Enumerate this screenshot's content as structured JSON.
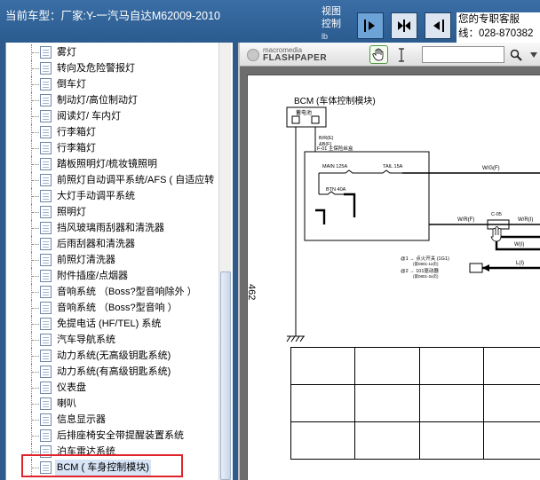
{
  "header": {
    "car_model": "当前车型：厂家:Y-一汽马自达M62009-2010",
    "view_control_label": "视图控制",
    "view_control_suffix": "lb",
    "contact_line1": "您的专职客服",
    "contact_line2": "线：028-870382"
  },
  "view_buttons": [
    {
      "icon": "arrow-right-bar-icon"
    },
    {
      "icon": "split-arrows-icon"
    },
    {
      "icon": "arrow-left-bar-icon"
    }
  ],
  "tree": {
    "items": [
      {
        "label": "雾灯"
      },
      {
        "label": "转向及危险警报灯"
      },
      {
        "label": "倒车灯"
      },
      {
        "label": "制动灯/高位制动灯"
      },
      {
        "label": "阅读灯/ 车内灯"
      },
      {
        "label": "行李箱灯"
      },
      {
        "label": "行李箱灯"
      },
      {
        "label": "踏板照明灯/梳妆镜照明"
      },
      {
        "label": "前照灯自动调平系统/AFS ( 自适应转"
      },
      {
        "label": "大灯手动调平系统"
      },
      {
        "label": "照明灯"
      },
      {
        "label": "挡风玻璃雨刮器和清洗器"
      },
      {
        "label": "后雨刮器和清洗器"
      },
      {
        "label": "前照灯清洗器"
      },
      {
        "label": "附件插座/点烟器"
      },
      {
        "label": "音响系统  （Boss?型音响除外 ）"
      },
      {
        "label": "音响系统  （Boss?型音响 ）"
      },
      {
        "label": "免提电话 (HF/TEL) 系统"
      },
      {
        "label": "汽车导航系统"
      },
      {
        "label": "动力系统(无高级钥匙系统)"
      },
      {
        "label": "动力系统(有高级钥匙系统)"
      },
      {
        "label": "仪表盘"
      },
      {
        "label": "喇叭"
      },
      {
        "label": "信息显示器"
      },
      {
        "label": "后排座椅安全带提醒装置系统"
      },
      {
        "label": "泊车雷达系统"
      },
      {
        "label": "BCM ( 车身控制模块)"
      }
    ],
    "selected_index": 26
  },
  "viewer": {
    "logo_top": "macromedia",
    "logo_bottom": "FLASHPAPER",
    "search_placeholder": "",
    "page_number": "462",
    "page_title": "BCM (车体控制模块)"
  },
  "schematic": {
    "battery_label": "蓄电池",
    "wire_br": "B/R(E)",
    "wire_sb": "&B(F)",
    "fuse_box": "F-01 主保险丝盒",
    "main_fuse": "MAIN 125A",
    "tail_fuse": "TAIL 15A",
    "btn_fuse": "BTN 40A",
    "wire_wgf": "W/G(F)",
    "wire_wrf": "W/R(F)",
    "wire_wrl": "W/R(I)",
    "wire_wli": "W(I)",
    "connector": "C-05",
    "switch1": "@1 → 点火开关 (1G1)",
    "switch1b": "(第0801-1a页)",
    "switch2": "@2 → 101驱动器",
    "switch2b": "(第0801-2a页)",
    "wire_l": "L(I)",
    "ground": ""
  },
  "colors": {
    "frame_blue": "#2e5b8c",
    "highlight_red": "#e0232b",
    "viewer_grey": "#6d6d6d"
  }
}
